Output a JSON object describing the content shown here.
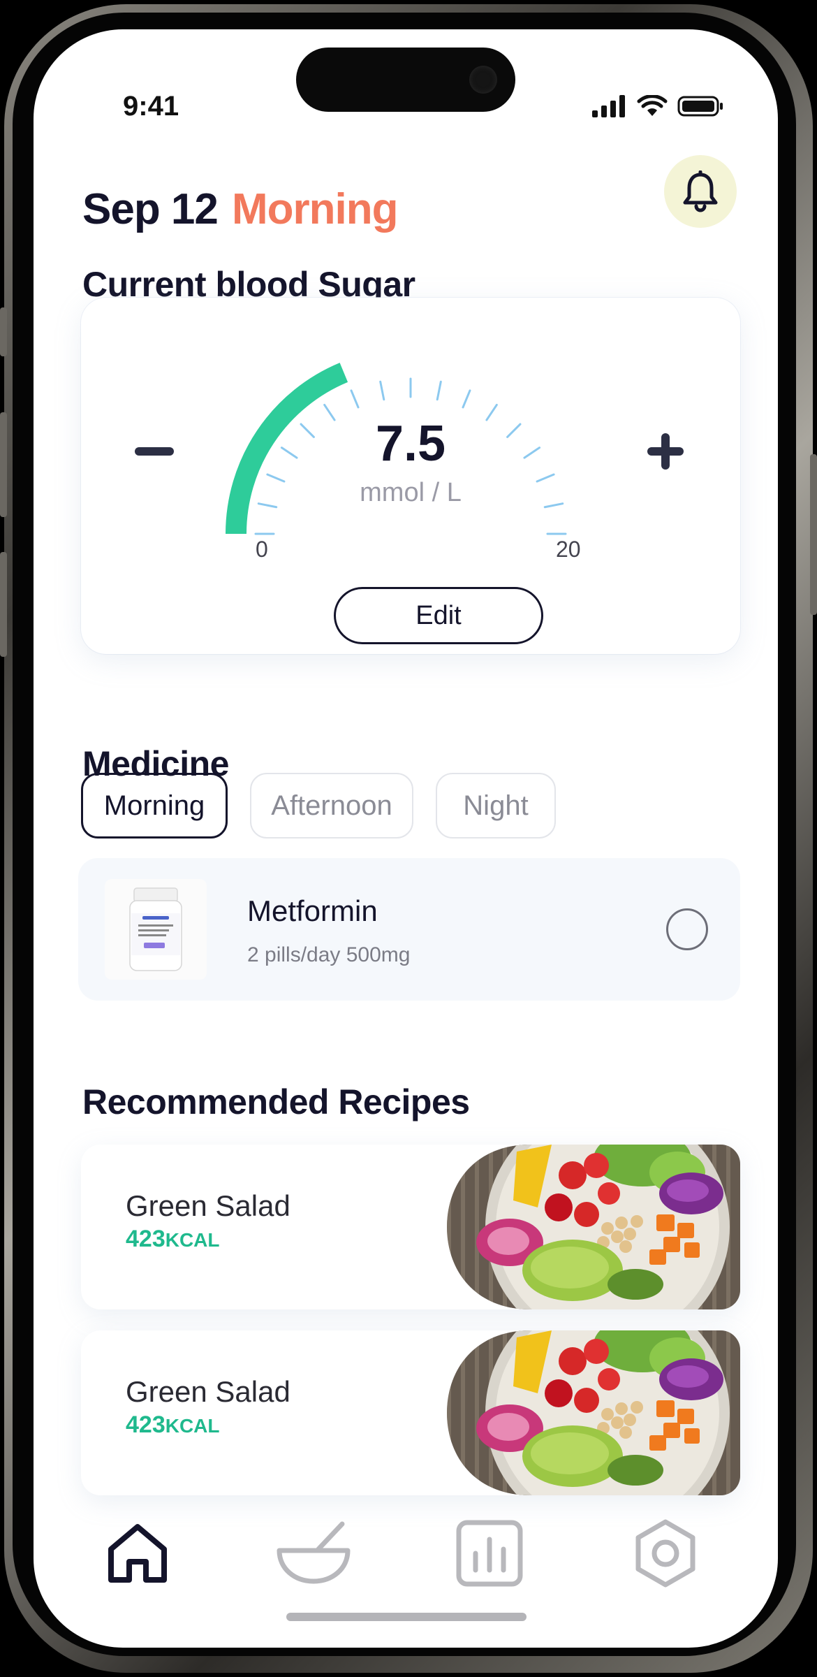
{
  "status_bar": {
    "time": "9:41"
  },
  "header": {
    "date": "Sep 12",
    "period": "Morning",
    "bell_icon": "bell-icon"
  },
  "blood_sugar": {
    "title": "Current blood Sugar",
    "value": "7.5",
    "unit": "mmol / L",
    "min_label": "0",
    "max_label": "20",
    "level_fraction": 0.375,
    "edit_label": "Edit",
    "accent_color": "#2ecc9a",
    "tick_color": "#8cc9ef"
  },
  "medicine": {
    "title": "Medicine",
    "tabs": [
      {
        "label": "Morning",
        "active": true
      },
      {
        "label": "Afternoon",
        "active": false
      },
      {
        "label": "Night",
        "active": false
      }
    ],
    "items": [
      {
        "name": "Metformin",
        "dose": "2 pills/day 500mg",
        "taken": false
      }
    ]
  },
  "recipes": {
    "title": "Recommended Recipes",
    "items": [
      {
        "name": "Green Salad",
        "kcal_value": "423",
        "kcal_unit": "KCAL"
      },
      {
        "name": "Green Salad",
        "kcal_value": "423",
        "kcal_unit": "KCAL"
      }
    ]
  },
  "tabbar": {
    "items": [
      {
        "icon": "home-icon",
        "active": true
      },
      {
        "icon": "bowl-icon",
        "active": false
      },
      {
        "icon": "chart-icon",
        "active": false
      },
      {
        "icon": "settings-icon",
        "active": false
      }
    ],
    "active_color": "#14142b",
    "inactive_color": "#b8b8bc"
  },
  "colors": {
    "accent_orange": "#f2795c",
    "kcal_green": "#1fb98d",
    "bell_bg": "#f4f4d6"
  }
}
